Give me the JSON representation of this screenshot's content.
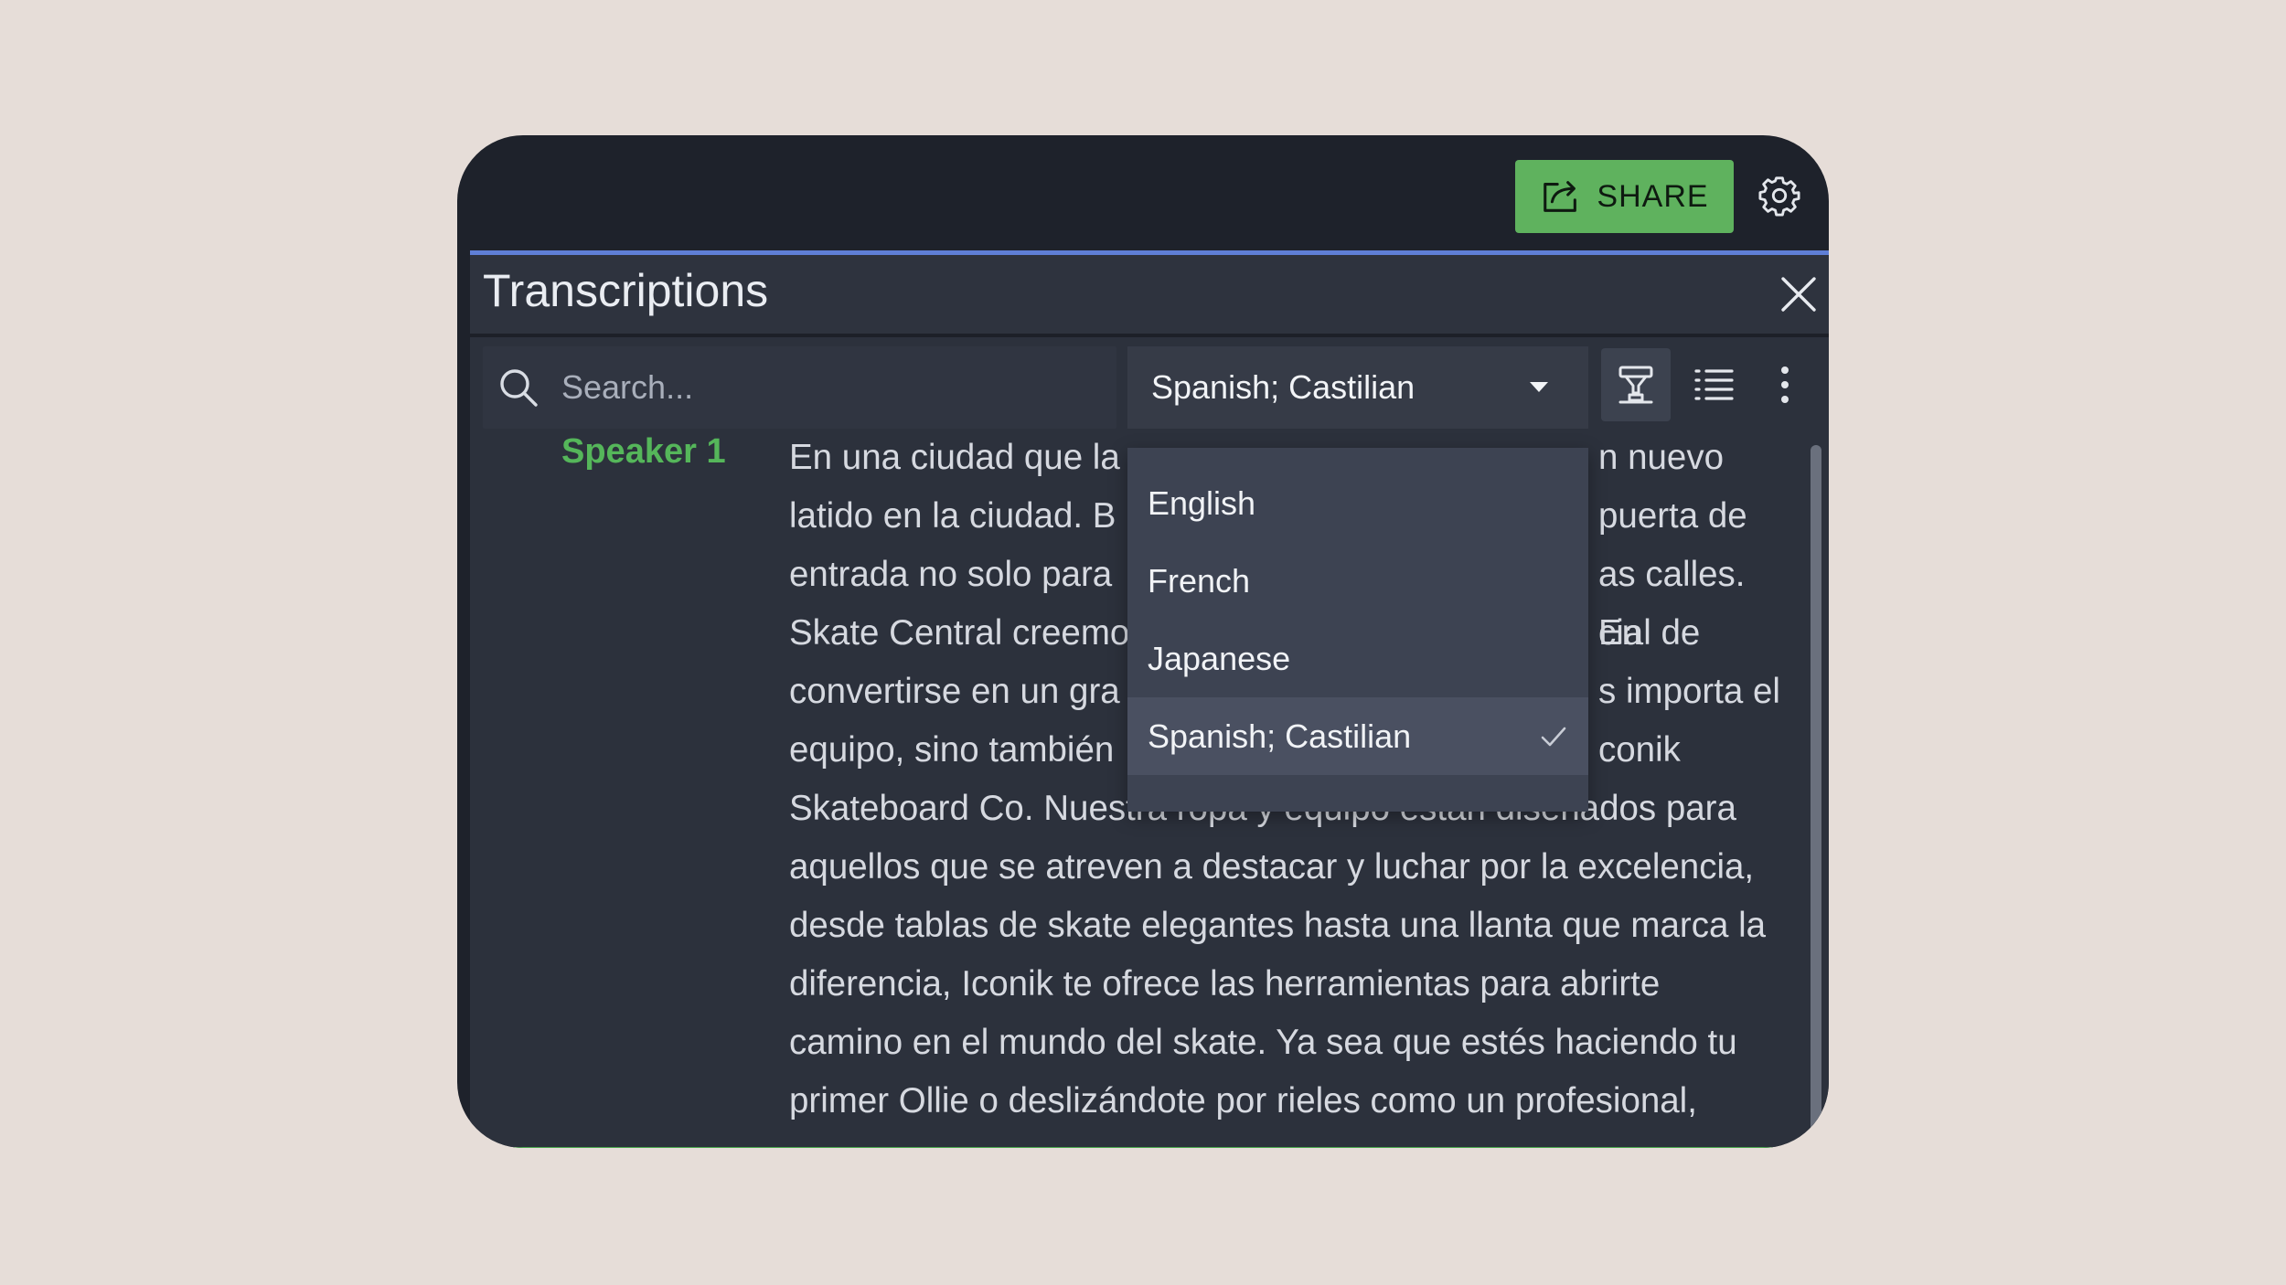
{
  "topbar": {
    "share_label": "SHARE"
  },
  "panel": {
    "title": "Transcriptions"
  },
  "search": {
    "placeholder": "Search..."
  },
  "language": {
    "selected": "Spanish; Castilian",
    "options": [
      "English",
      "French",
      "Japanese",
      "Spanish; Castilian"
    ]
  },
  "transcript": {
    "speaker": "Speaker 1",
    "text": "En una ciudad que la… n nuevo latido en la ciudad. B… puerta de entrada no solo para… as calles. En Skate Central creemo… cial de convertirse en un gra… s importa el equipo, sino también… conik Skateboard Co. Nuestra ropa y equipo están diseñados para aquellos que se atreven a destacar y luchar por la excelencia, desde tablas de skate elegantes hasta una llanta que marca la diferencia, Iconik te ofrece las herramientas para abrirte camino en el mundo del skate. Ya sea que estés haciendo tu primer Ollie o deslizándote por rieles como un profesional,",
    "lines": [
      "En una ciudad que la",
      "n nuevo",
      "latido en la ciudad. B",
      "puerta de",
      "entrada no solo para",
      "as calles. En",
      "Skate Central creemo",
      "cial de",
      "convertirse en un gra",
      "s importa el",
      "equipo, sino también",
      "conik",
      "Skateboard Co. Nuestra ropa y equipo están diseñados para",
      "aquellos que se atreven a destacar y luchar por la excelencia,",
      "desde tablas de skate elegantes hasta una llanta que marca la",
      "diferencia, Iconik te ofrece las herramientas para abrirte",
      "camino en el mundo del skate. Ya sea que estés haciendo tu",
      "primer Ollie o deslizándote por rieles como un profesional,"
    ]
  },
  "colors": {
    "share_bg": "#5fb25e",
    "speaker": "#55b65a",
    "panel_accent": "#5f7fd6",
    "bottom_accent": "#45a449"
  },
  "icons": {
    "share": "share-icon",
    "settings": "gear-icon",
    "close": "close-icon",
    "search": "search-icon",
    "caret": "caret-down-icon",
    "highlight": "highlighter-icon",
    "list": "list-icon",
    "more": "more-vertical-icon",
    "check": "check-icon"
  }
}
